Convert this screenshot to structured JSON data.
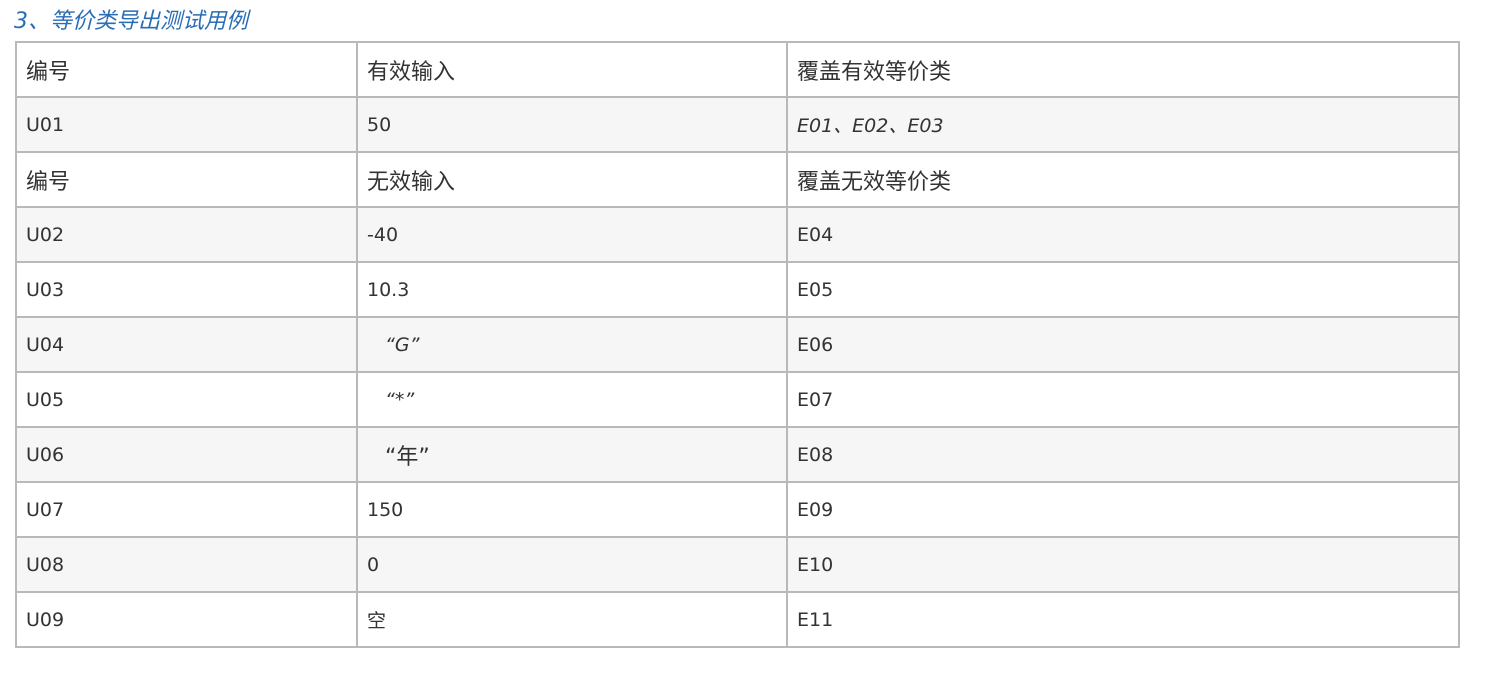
{
  "heading": "3、等价类导出测试用例",
  "header_valid": [
    "编号",
    "有效输入",
    "覆盖有效等价类"
  ],
  "row_u01": [
    "U01",
    "50",
    "E01、E02、E03"
  ],
  "header_invalid": [
    "编号",
    "无效输入",
    "覆盖无效等价类"
  ],
  "invalid_rows": [
    [
      "U02",
      "-40",
      "E04"
    ],
    [
      "U03",
      "10.3",
      "E05"
    ],
    [
      "U04",
      "“G”",
      "E06"
    ],
    [
      "U05",
      "“*”",
      "E07"
    ],
    [
      "U06",
      "“年”",
      "E08"
    ],
    [
      "U07",
      "150",
      "E09"
    ],
    [
      "U08",
      "0",
      "E10"
    ],
    [
      "U09",
      "空",
      "E11"
    ]
  ]
}
